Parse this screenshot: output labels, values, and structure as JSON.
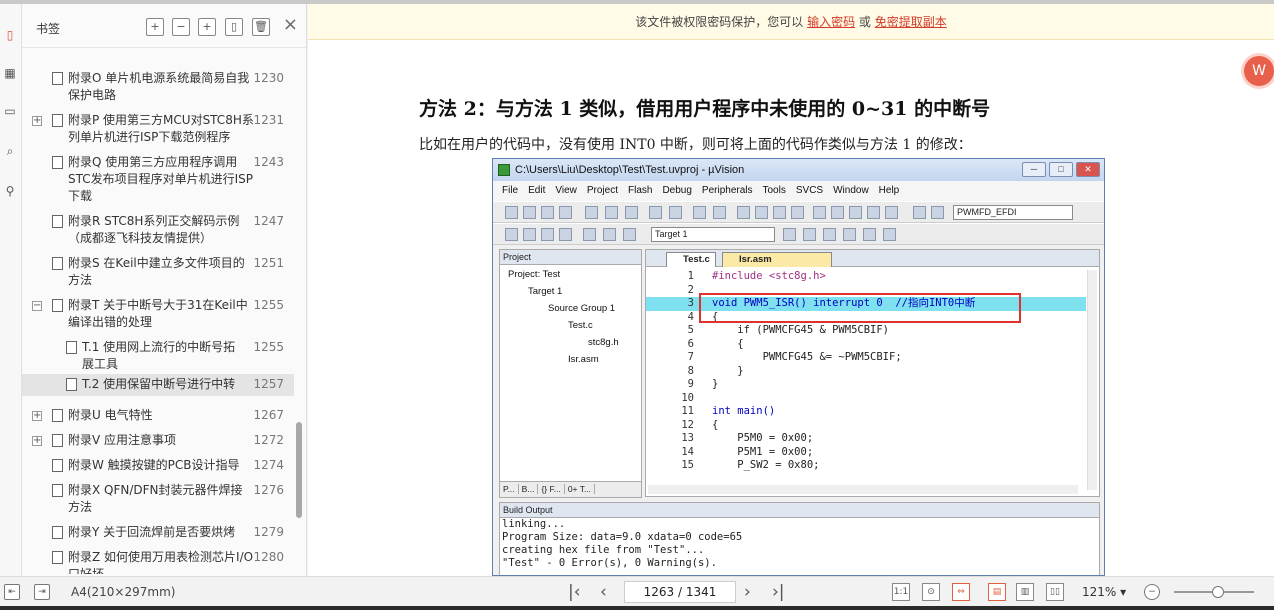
{
  "sidebar": {
    "title": "书签",
    "tools": [
      "add-bookmark-icon",
      "remove-bookmark-icon",
      "bookmark-icon",
      "bookmark-outline-icon",
      "delete-icon"
    ],
    "items": [
      {
        "text": "附录O 单片机电源系统最简易自我保护电路",
        "page": "1230",
        "expand": ""
      },
      {
        "text": "附录P 使用第三方MCU对STC8H系列单片机进行ISP下载范例程序",
        "page": "1231",
        "expand": "+"
      },
      {
        "text": "附录Q 使用第三方应用程序调用STC发布项目程序对单片机进行ISP下载",
        "page": "1243",
        "expand": ""
      },
      {
        "text": "附录R STC8H系列正交解码示例（成都逐飞科技友情提供）",
        "page": "1247",
        "expand": ""
      },
      {
        "text": "附录S 在Keil中建立多文件项目的方法",
        "page": "1251",
        "expand": ""
      },
      {
        "text": "附录T 关于中断号大于31在Keil中编译出错的处理",
        "page": "1255",
        "expand": "−"
      },
      {
        "text": "T.1 使用网上流行的中断号拓展工具",
        "page": "1255",
        "expand": ""
      },
      {
        "text": "T.2 使用保留中断号进行中转",
        "page": "1257",
        "expand": ""
      },
      {
        "text": "附录U 电气特性",
        "page": "1267",
        "expand": "+"
      },
      {
        "text": "附录V 应用注意事项",
        "page": "1272",
        "expand": "+"
      },
      {
        "text": "附录W 触摸按键的PCB设计指导",
        "page": "1274",
        "expand": ""
      },
      {
        "text": "附录X QFN/DFN封装元器件焊接方法",
        "page": "1276",
        "expand": ""
      },
      {
        "text": "附录Y 关于回流焊前是否要烘烤",
        "page": "1279",
        "expand": ""
      },
      {
        "text": "附录Z 如何使用万用表检测芯片I/O口好坏",
        "page": "1280",
        "expand": ""
      }
    ]
  },
  "banner": {
    "text": "该文件被权限密码保护，您可以",
    "link1": "输入密码",
    "or": "或",
    "link2": "免密提取副本"
  },
  "doc": {
    "heading": "方法 2：与方法 1 类似，借用用户程序中未使用的 0~31 的中断号",
    "paragraph": "比如在用户的代码中，没有使用 INT0 中断，则可将上面的代码作类似与方法 1 的修改："
  },
  "uvision": {
    "title": "C:\\Users\\Liu\\Desktop\\Test\\Test.uvproj - µVision",
    "menu": [
      "File",
      "Edit",
      "View",
      "Project",
      "Flash",
      "Debug",
      "Peripherals",
      "Tools",
      "SVCS",
      "Window",
      "Help"
    ],
    "toolbar_select1": "PWMFD_EFDI",
    "toolbar_select2": "Target 1",
    "project_label": "Project",
    "tree": [
      "Project: Test",
      "Target 1",
      "Source Group 1",
      "Test.c",
      "stc8g.h",
      "Isr.asm"
    ],
    "proj_tabs": [
      "P...",
      "B...",
      "{} F...",
      "0+ T..."
    ],
    "tabs": [
      "Test.c",
      "Isr.asm"
    ],
    "code": [
      {
        "n": "1",
        "t": "#include <stc8g.h>"
      },
      {
        "n": "2",
        "t": ""
      },
      {
        "n": "3",
        "t": "void PWM5_ISR() interrupt 0  //指向INT0中断"
      },
      {
        "n": "4",
        "t": "{"
      },
      {
        "n": "5",
        "t": "    if (PWMCFG45 & PWM5CBIF)"
      },
      {
        "n": "6",
        "t": "    {"
      },
      {
        "n": "7",
        "t": "        PWMCFG45 &= ~PWM5CBIF;"
      },
      {
        "n": "8",
        "t": "    }"
      },
      {
        "n": "9",
        "t": "}"
      },
      {
        "n": "10",
        "t": ""
      },
      {
        "n": "11",
        "t": "int main()"
      },
      {
        "n": "12",
        "t": "{"
      },
      {
        "n": "13",
        "t": "    P5M0 = 0x00;"
      },
      {
        "n": "14",
        "t": "    P5M1 = 0x00;"
      },
      {
        "n": "15",
        "t": "    P_SW2 = 0x80;"
      }
    ],
    "build_label": "Build Output",
    "build_lines": [
      "linking...",
      "Program Size: data=9.0 xdata=0 code=65",
      "creating hex file from \"Test\"...",
      "\"Test\" - 0 Error(s), 0 Warning(s)."
    ]
  },
  "status": {
    "paper": "A4(210×297mm)",
    "page": "1263 / 1341",
    "zoom": "121%",
    "zoom_level": 0.55
  }
}
